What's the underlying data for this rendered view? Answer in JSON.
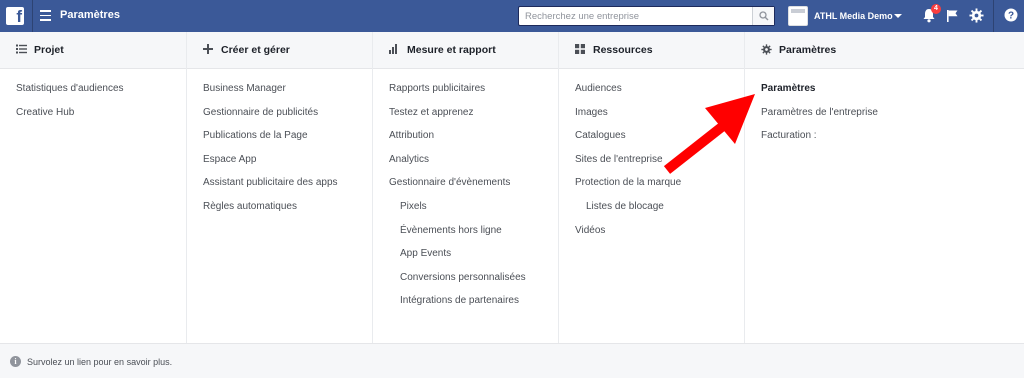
{
  "topbar": {
    "logo": "f",
    "title": "Paramètres",
    "search_placeholder": "Recherchez une entreprise",
    "account_name": "ATHL Media Demo",
    "notification_count": "4",
    "icons": [
      "facebook-logo-icon",
      "hamburger-icon",
      "search-icon",
      "bell-icon",
      "flag-icon",
      "gear-icon",
      "help-icon"
    ]
  },
  "columns": [
    {
      "heading": "Projet",
      "icon": "list-icon",
      "items": [
        {
          "label": "Statistiques d'audiences"
        },
        {
          "label": "Creative Hub"
        }
      ]
    },
    {
      "heading": "Créer et gérer",
      "icon": "plus-icon",
      "items": [
        {
          "label": "Business Manager"
        },
        {
          "label": "Gestionnaire de publicités"
        },
        {
          "label": "Publications de la Page"
        },
        {
          "label": "Espace App"
        },
        {
          "label": "Assistant publicitaire des apps"
        },
        {
          "label": "Règles automatiques"
        }
      ]
    },
    {
      "heading": "Mesure et rapport",
      "icon": "bar-chart-icon",
      "items": [
        {
          "label": "Rapports publicitaires"
        },
        {
          "label": "Testez et apprenez"
        },
        {
          "label": "Attribution"
        },
        {
          "label": "Analytics"
        },
        {
          "label": "Gestionnaire d'évènements"
        },
        {
          "label": "Pixels",
          "sub": true
        },
        {
          "label": "Évènements hors ligne",
          "sub": true
        },
        {
          "label": "App Events",
          "sub": true
        },
        {
          "label": "Conversions personnalisées",
          "sub": true
        },
        {
          "label": "Intégrations de partenaires",
          "sub": true
        }
      ]
    },
    {
      "heading": "Ressources",
      "icon": "grid-icon",
      "items": [
        {
          "label": "Audiences"
        },
        {
          "label": "Images"
        },
        {
          "label": "Catalogues"
        },
        {
          "label": "Sites de l'entreprise"
        },
        {
          "label": "Protection de la marque"
        },
        {
          "label": "Listes de blocage",
          "sub": true
        },
        {
          "label": "Vidéos"
        }
      ]
    },
    {
      "heading": "Paramètres",
      "icon": "gear-icon",
      "items": [
        {
          "label": "Paramètres",
          "active": true
        },
        {
          "label": "Paramètres de l'entreprise"
        },
        {
          "label": "Facturation :"
        }
      ]
    }
  ],
  "footer": {
    "info_icon": "info-icon",
    "text": "Survolez un lien pour en savoir plus."
  },
  "colors": {
    "topbar": "#3b5998",
    "annotation_arrow": "#ff0000",
    "notification_badge": "#fa3e3e"
  }
}
